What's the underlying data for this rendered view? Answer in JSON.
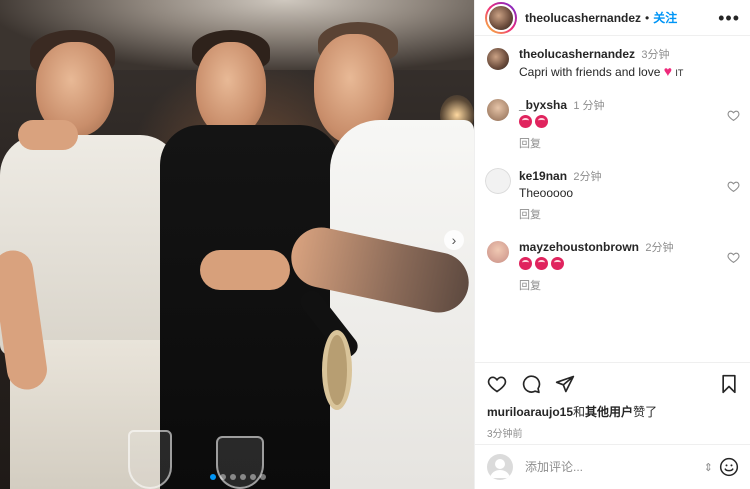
{
  "post": {
    "username": "theolucashernandez",
    "follow_label": "关注",
    "more_label": "•••",
    "caption": {
      "username": "theolucashernandez",
      "time": "3分钟",
      "text": "Capri with friends and love",
      "heart": "♥",
      "flag": "IT"
    },
    "comments": [
      {
        "username": "_byxsha",
        "time": "1 分钟",
        "text": "",
        "emoji_count": 2,
        "reply_label": "回复"
      },
      {
        "username": "ke19nan",
        "time": "2分钟",
        "text": "Theooooo",
        "emoji_count": 0,
        "reply_label": "回复"
      },
      {
        "username": "mayzehoustonbrown",
        "time": "2分钟",
        "text": "",
        "emoji_count": 3,
        "reply_label": "回复"
      }
    ],
    "likes": {
      "user": "muriloaraujo15",
      "connector": "和",
      "others": "其他用户",
      "suffix": "赞了"
    },
    "posted_time": "3分钟前",
    "add_comment_placeholder": "添加评论...",
    "carousel": {
      "dot_count": 6,
      "active_index": 0
    }
  },
  "colors": {
    "accent": "#0095f6",
    "text": "#262626",
    "secondary": "#8e8e8e",
    "border": "#efefef"
  }
}
